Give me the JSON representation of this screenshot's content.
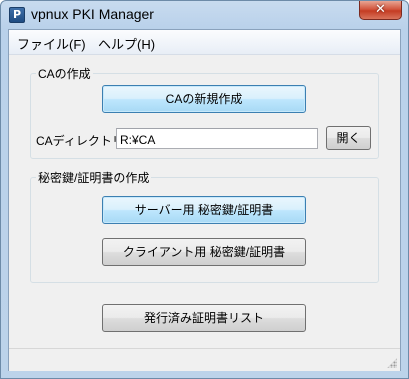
{
  "window": {
    "title": "vpnux PKI Manager",
    "close_glyph": "✕",
    "icon_letter": "P"
  },
  "menu": {
    "items": [
      {
        "label": "ファイル(F)"
      },
      {
        "label": "ヘルプ(H)"
      }
    ]
  },
  "ca_group": {
    "title": "CAの作成",
    "new_ca_button": "CAの新規作成",
    "directory_label": "CAディレクトリ：",
    "directory_value": "R:¥CA",
    "open_button": "開く"
  },
  "key_group": {
    "title": "秘密鍵/証明書の作成",
    "server_button": "サーバー用 秘密鍵/証明書",
    "client_button": "クライアント用 秘密鍵/証明書"
  },
  "issued_list_button": "発行済み証明書リスト",
  "colors": {
    "accent_border": "#3c7fb1",
    "window_frame": "#b9d1ea",
    "close_button": "#c43c23"
  }
}
